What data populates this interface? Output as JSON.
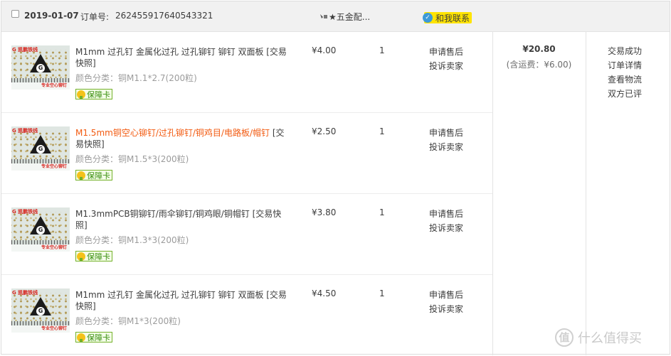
{
  "order": {
    "date": "2019-01-07",
    "order_no_label": "订单号:",
    "order_no": "262455917640543321",
    "shop_name": "★五金配...",
    "contact_label": "和我联系",
    "total": "¥20.80",
    "shipping": "(含运费：¥6.00)",
    "status_links": [
      "交易成功",
      "订单详情",
      "查看物流",
      "双方已评"
    ]
  },
  "items": [
    {
      "title": "M1mm 过孔钉 金属化过孔 过孔铆钉 铆钉 双面板 [交易快照]",
      "title_link": "",
      "title_tail": "",
      "sku": "颜色分类：铜M1.1*2.7(200粒)",
      "badge": "保障卡",
      "price": "¥4.00",
      "qty": "1",
      "actions": [
        "申请售后",
        "投诉卖家"
      ],
      "thumb_brand": "G 凯鹏铁线",
      "thumb_caption": "专业空心铆钉"
    },
    {
      "title": "",
      "title_link": "M1.5mm铜空心铆钉/过孔铆钉/铜鸡目/电路板/帽钉",
      "title_tail": " [交易快照]",
      "sku": "颜色分类：铜M1.5*3(200粒)",
      "badge": "保障卡",
      "price": "¥2.50",
      "qty": "1",
      "actions": [
        "申请售后",
        "投诉卖家"
      ],
      "thumb_brand": "G 凯鹏铁线",
      "thumb_caption": "专业空心铆钉"
    },
    {
      "title": "M1.3mmPCB铜铆钉/雨伞铆钉/铜鸡眼/铜帽钉 [交易快照]",
      "title_link": "",
      "title_tail": "",
      "sku": "颜色分类：铜M1.3*3(200粒)",
      "badge": "保障卡",
      "price": "¥3.80",
      "qty": "1",
      "actions": [
        "申请售后",
        "投诉卖家"
      ],
      "thumb_brand": "G 凯鹏铁线",
      "thumb_caption": "专业空心铆钉"
    },
    {
      "title": "M1mm 过孔钉 金属化过孔 过孔铆钉 铆钉 双面板 [交易快照]",
      "title_link": "",
      "title_tail": "",
      "sku": "颜色分类：铜M1*3(200粒)",
      "badge": "保障卡",
      "price": "¥4.50",
      "qty": "1",
      "actions": [
        "申请售后",
        "投诉卖家"
      ],
      "thumb_brand": "G 凯鹏铁线",
      "thumb_caption": "专业空心铆钉"
    }
  ],
  "watermark": {
    "icon": "值",
    "text": "什么值得买"
  },
  "colors": {
    "header_bg": "#f1f1f1",
    "link_orange": "#f25a10",
    "contact_yellow": "#ffe400",
    "badge_green": "#74b12a"
  }
}
